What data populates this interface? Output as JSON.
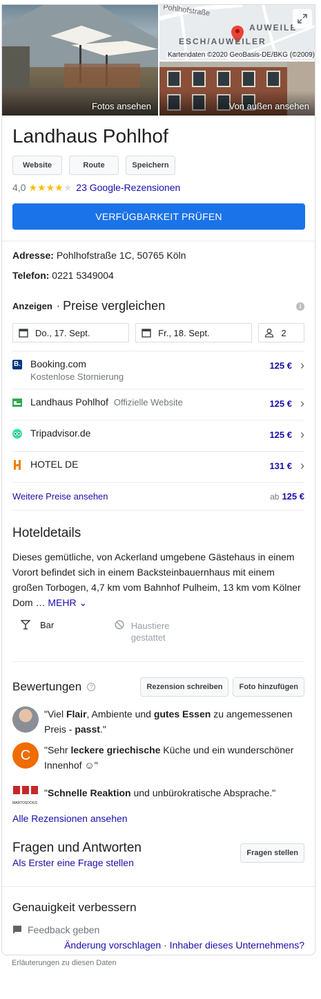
{
  "photos": {
    "main_caption": "Fotos ansehen",
    "exterior_caption": "Von außen ansehen",
    "map_street": "Pohlhofstraße",
    "map_label1": "ESCH/AUWEILER",
    "map_label2": "AUWEILE",
    "map_copyright": "Kartendaten ©2020 GeoBasis-DE/BKG (©2009)"
  },
  "header": {
    "title": "Landhaus Pohlhof",
    "buttons": [
      "Website",
      "Route",
      "Speichern"
    ],
    "rating": "4,0",
    "stars": 4,
    "reviews_link": "23 Google-Rezensionen",
    "availability_button": "VERFÜGBARKEIT PRÜFEN"
  },
  "info": {
    "address_label": "Adresse:",
    "address": "Pohlhofstraße 1C, 50765 Köln",
    "phone_label": "Telefon:",
    "phone": "0221 5349004"
  },
  "prices": {
    "ads_label": "Anzeigen",
    "separator": "·",
    "title": "Preise vergleichen",
    "checkin": "Do., 17. Sept.",
    "checkout": "Fr., 18. Sept.",
    "guests": "2",
    "providers": [
      {
        "name": "Booking.com",
        "sub": "Kostenlose Stornierung",
        "tag": "",
        "price": "125 €",
        "icon": "booking-icon",
        "color": "#003580"
      },
      {
        "name": "Landhaus Pohlhof",
        "sub": "",
        "tag": "Offizielle Website",
        "price": "125 €",
        "icon": "hotel-bed-icon",
        "color": "#34a853"
      },
      {
        "name": "Tripadvisor.de",
        "sub": "",
        "tag": "",
        "price": "125 €",
        "icon": "tripadvisor-icon",
        "color": "#34e0a1"
      },
      {
        "name": "HOTEL DE",
        "sub": "",
        "tag": "",
        "price": "131 €",
        "icon": "hotelde-icon",
        "color": "#f57c00"
      }
    ],
    "more_link": "Weitere Preise ansehen",
    "from_label": "ab",
    "from_price": "125 €"
  },
  "details": {
    "title": "Hoteldetails",
    "description": "Dieses gemütliche, von Ackerland umgebene Gästehaus in einem Vorort befindet sich in einem Backsteinbauernhaus mit einem großen Torbogen, 4,7 km vom Bahnhof Pulheim, 13 km vom Kölner Dom … ",
    "more": "MEHR",
    "amenity_bar": "Bar",
    "amenity_pets": "Haustiere gestattet"
  },
  "reviews": {
    "title": "Bewertungen",
    "write_button": "Rezension schreiben",
    "photo_button": "Foto hinzufügen",
    "items": [
      {
        "parts": [
          "\"Viel ",
          "Flair",
          ", Ambiente und ",
          "gutes Essen",
          " zu angemessenen Preis - ",
          "passt",
          ".\""
        ]
      },
      {
        "parts": [
          "\"Sehr ",
          "leckere griechische",
          " Küche und ein wunderschöner Innenhof ",
          "☺",
          "\""
        ]
      },
      {
        "parts": [
          "\"",
          "Schnelle Reaktion",
          " und unbürokratische Absprache.\""
        ]
      }
    ],
    "avatar_c_letter": "C",
    "avatar_logo_text": "MARTOSDOGS",
    "all_link": "Alle Rezensionen ansehen"
  },
  "faq": {
    "title": "Fragen und Antworten",
    "link": "Als Erster eine Frage stellen",
    "button": "Fragen stellen"
  },
  "accuracy": {
    "title": "Genauigkeit verbessern",
    "feedback": "Feedback geben",
    "suggest": "Änderung vorschlagen",
    "dot": " · ",
    "owner": "Inhaber dieses Unternehmens?"
  },
  "footnote": "Erläuterungen zu diesen Daten",
  "colors": {
    "link": "#1a0dab",
    "primary": "#1a73e8",
    "star": "#fbbc04"
  }
}
